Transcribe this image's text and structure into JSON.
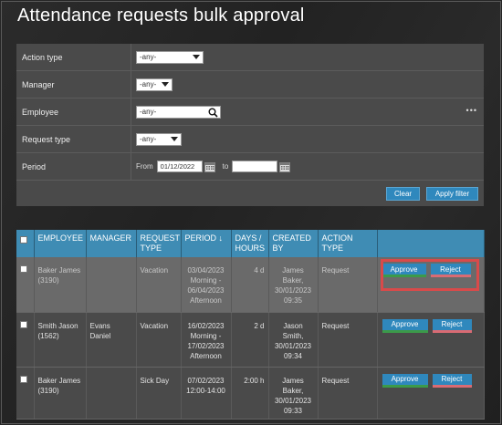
{
  "title": "Attendance requests bulk approval",
  "filters": {
    "action_type": {
      "label": "Action type",
      "value": "-any-"
    },
    "manager": {
      "label": "Manager",
      "value": "-any-"
    },
    "employee": {
      "label": "Employee",
      "value": "-any-",
      "more": "•••"
    },
    "request_type": {
      "label": "Request type",
      "value": "-any-"
    },
    "period": {
      "label": "Period",
      "from_label": "From",
      "from_value": "01/12/2022",
      "to_label": "to",
      "to_value": ""
    }
  },
  "buttons": {
    "clear": "Clear",
    "apply": "Apply filter"
  },
  "table": {
    "headers": {
      "employee": "EMPLOYEE",
      "manager": "MANAGER",
      "request_type": "REQUEST TYPE",
      "period": "PERIOD ↓",
      "days_hours": "DAYS / HOURS",
      "created_by": "CREATED BY",
      "action_type": "ACTION TYPE"
    },
    "rows": [
      {
        "employee": "Baker James (3190)",
        "manager": "",
        "request_type": "Vacation",
        "period": "03/04/2023 Morning - 06/04/2023 Afternoon",
        "days_hours": "4 d",
        "created_by": "James Baker, 30/01/2023 09:35",
        "action_type": "Request",
        "approve": "Approve",
        "reject": "Reject"
      },
      {
        "employee": "Smith Jason (1562)",
        "manager": "Evans Daniel",
        "request_type": "Vacation",
        "period": "16/02/2023 Morning - 17/02/2023 Afternoon",
        "days_hours": "2 d",
        "created_by": "Jason Smith, 30/01/2023 09:34",
        "action_type": "Request",
        "approve": "Approve",
        "reject": "Reject"
      },
      {
        "employee": "Baker James (3190)",
        "manager": "",
        "request_type": "Sick Day",
        "period": "07/02/2023 12:00-14:00",
        "days_hours": "2:00 h",
        "created_by": "James Baker, 30/01/2023 09:33",
        "action_type": "Request",
        "approve": "Approve",
        "reject": "Reject"
      }
    ]
  },
  "colors": {
    "accent": "#3f8cb4",
    "approve_underline": "#3c9a4a",
    "reject_underline": "#d96b73",
    "highlight": "#d94a4a"
  }
}
